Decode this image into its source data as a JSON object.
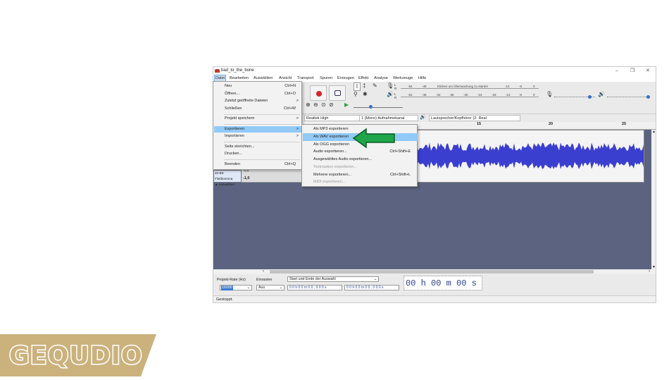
{
  "window": {
    "title": "bad_to_the_bone"
  },
  "menubar": {
    "items": [
      "Datei",
      "Bearbeiten",
      "Auswählen",
      "Ansicht",
      "Transport",
      "Spuren",
      "Erzeugen",
      "Effekt",
      "Analyse",
      "Werkzeuge",
      "Hilfe"
    ]
  },
  "toolbar": {
    "meter_hint": "Klicken um Überwachung zu starten",
    "meter_ticks": [
      "-54",
      "-48",
      "-12",
      "-6",
      "0"
    ],
    "meter_ticks2": [
      "-54",
      "-48",
      "-42",
      "-36",
      "-30",
      "-24",
      "-18",
      "-12",
      "-6",
      "0"
    ],
    "lr": [
      "L",
      "R",
      "L",
      "R"
    ]
  },
  "devices": {
    "input": "Realtek High",
    "channels": "1 (Mono) Aufnahmekanal",
    "output": "Lautsprecher/Kopfhörer (2- Real"
  },
  "ruler": {
    "ticks": [
      "15",
      "20",
      "25"
    ]
  },
  "track": {
    "format": "32-Bit-Fließkomma",
    "select": "Auswählen",
    "scale_top": "-0,5",
    "scale_bottom": "-1,0"
  },
  "file_menu": {
    "items": [
      {
        "label": "Neu",
        "shortcut": "Ctrl+N"
      },
      {
        "label": "Öffnen...",
        "shortcut": "Ctrl+O"
      },
      {
        "label": "Zuletzt geöffnete Dateien",
        "shortcut": ">"
      },
      {
        "label": "Schließen",
        "shortcut": "Ctrl+W"
      },
      {
        "label": "Projekt speichern",
        "shortcut": ">"
      },
      {
        "label": "Exportieren",
        "shortcut": ">"
      },
      {
        "label": "Importieren",
        "shortcut": ">"
      },
      {
        "label": "Seite einrichten...",
        "shortcut": ""
      },
      {
        "label": "Drucken...",
        "shortcut": ""
      },
      {
        "label": "Beenden",
        "shortcut": "Ctrl+Q"
      }
    ]
  },
  "export_menu": {
    "items": [
      {
        "label": "Als MP3 exportieren",
        "shortcut": "",
        "disabled": false
      },
      {
        "label": "Als WAV exportieren",
        "shortcut": "",
        "disabled": false
      },
      {
        "label": "Als OGG exportieren",
        "shortcut": "",
        "disabled": false
      },
      {
        "label": "Audio exportieren...",
        "shortcut": "Ctrl+Shift+E",
        "disabled": false
      },
      {
        "label": "Ausgewähltes Audio exportieren...",
        "shortcut": "",
        "disabled": false
      },
      {
        "label": "Textmarken exportieren...",
        "shortcut": "",
        "disabled": true
      },
      {
        "label": "Mehrere exportieren...",
        "shortcut": "Ctrl+Shift+L",
        "disabled": false
      },
      {
        "label": "MIDI exportieren...",
        "shortcut": "",
        "disabled": true
      }
    ]
  },
  "bottom": {
    "rate_label": "Projekt-Rate (Hz)",
    "rate_value": "16000",
    "snap_label": "Einrasten",
    "snap_value": "Aus",
    "selection_label": "Start und Ende der Auswahl",
    "sel_start": "0 0 h 0 0 m 0 0 , 0 0 0 s",
    "sel_end": "0 0 h 0 0 m 0 0 , 0 0 0 s",
    "time": "00 h 00 m 00 s"
  },
  "status": {
    "text": "Gestoppt."
  },
  "logo": {
    "text": "GEQUDIO"
  },
  "colors": {
    "highlight": "#91c9f7",
    "arrow": "#1fa64a",
    "track_bg": "#5b6381",
    "wave": "#3b3fd0",
    "logo_gold": "#cbb27d"
  }
}
